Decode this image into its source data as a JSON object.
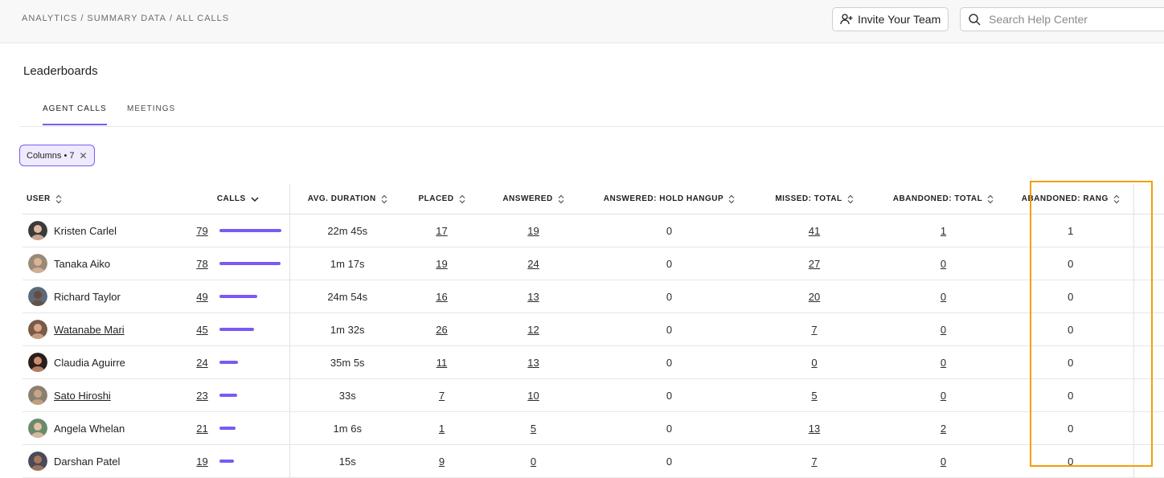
{
  "breadcrumb": [
    "ANALYTICS",
    "SUMMARY DATA",
    "ALL CALLS"
  ],
  "header": {
    "invite_label": "Invite Your Team",
    "invite_icon": "user-plus-icon",
    "search_placeholder": "Search Help Center",
    "search_icon": "search-icon"
  },
  "section_title": "Leaderboards",
  "tabs": [
    {
      "label": "AGENT CALLS",
      "active": true
    },
    {
      "label": "MEETINGS",
      "active": false
    }
  ],
  "filter_chip": {
    "label": "Columns • 7",
    "close_icon": "close-icon"
  },
  "table": {
    "columns": [
      {
        "label": "USER",
        "sort": "sortable"
      },
      {
        "label": "CALLS",
        "sort": "descending"
      },
      {
        "label": "AVG. DURATION",
        "sort": "sortable"
      },
      {
        "label": "PLACED",
        "sort": "sortable"
      },
      {
        "label": "ANSWERED",
        "sort": "sortable"
      },
      {
        "label": "ANSWERED: HOLD HANGUP",
        "sort": "sortable"
      },
      {
        "label": "MISSED: TOTAL",
        "sort": "sortable"
      },
      {
        "label": "ABANDONED: TOTAL",
        "sort": "sortable"
      },
      {
        "label": "ABANDONED: RANG",
        "sort": "sortable"
      }
    ],
    "max_calls": 79,
    "rows": [
      {
        "user": "Kristen Carlel",
        "user_link": false,
        "calls": "79",
        "avg_duration": "22m 45s",
        "placed": "17",
        "answered": "19",
        "hold_hangup": "0",
        "missed": "41",
        "abandoned_total": "1",
        "abandoned_rang": "1",
        "avatar_bg": "#3a3a3a",
        "avatar_skin": "#e0b8a0"
      },
      {
        "user": "Tanaka Aiko",
        "user_link": false,
        "calls": "78",
        "avg_duration": "1m 17s",
        "placed": "19",
        "answered": "24",
        "hold_hangup": "0",
        "missed": "27",
        "abandoned_total": "0",
        "abandoned_rang": "0",
        "avatar_bg": "#9a8a78",
        "avatar_skin": "#d9b596"
      },
      {
        "user": "Richard Taylor",
        "user_link": false,
        "calls": "49",
        "avg_duration": "24m 54s",
        "placed": "16",
        "answered": "13",
        "hold_hangup": "0",
        "missed": "20",
        "abandoned_total": "0",
        "abandoned_rang": "0",
        "avatar_bg": "#5a6a7a",
        "avatar_skin": "#6b4a3a"
      },
      {
        "user": "Watanabe Mari",
        "user_link": true,
        "calls": "45",
        "avg_duration": "1m 32s",
        "placed": "26",
        "answered": "12",
        "hold_hangup": "0",
        "missed": "7",
        "abandoned_total": "0",
        "abandoned_rang": "0",
        "avatar_bg": "#7a5a48",
        "avatar_skin": "#d8a888"
      },
      {
        "user": "Claudia Aguirre",
        "user_link": false,
        "calls": "24",
        "avg_duration": "35m 5s",
        "placed": "11",
        "answered": "13",
        "hold_hangup": "0",
        "missed": "0",
        "abandoned_total": "0",
        "abandoned_rang": "0",
        "avatar_bg": "#2a1e1a",
        "avatar_skin": "#c98e6e"
      },
      {
        "user": "Sato Hiroshi",
        "user_link": true,
        "calls": "23",
        "avg_duration": "33s",
        "placed": "7",
        "answered": "10",
        "hold_hangup": "0",
        "missed": "5",
        "abandoned_total": "0",
        "abandoned_rang": "0",
        "avatar_bg": "#8a8070",
        "avatar_skin": "#c9a484"
      },
      {
        "user": "Angela Whelan",
        "user_link": false,
        "calls": "21",
        "avg_duration": "1m 6s",
        "placed": "1",
        "answered": "5",
        "hold_hangup": "0",
        "missed": "13",
        "abandoned_total": "2",
        "abandoned_rang": "0",
        "avatar_bg": "#6a8a6a",
        "avatar_skin": "#e4c0a4"
      },
      {
        "user": "Darshan Patel",
        "user_link": false,
        "calls": "19",
        "avg_duration": "15s",
        "placed": "9",
        "answered": "0",
        "hold_hangup": "0",
        "missed": "7",
        "abandoned_total": "0",
        "abandoned_rang": "0",
        "avatar_bg": "#4a4a5a",
        "avatar_skin": "#a8785a"
      }
    ]
  },
  "colors": {
    "accent": "#7a5af5",
    "highlight": "#f59e0b"
  }
}
